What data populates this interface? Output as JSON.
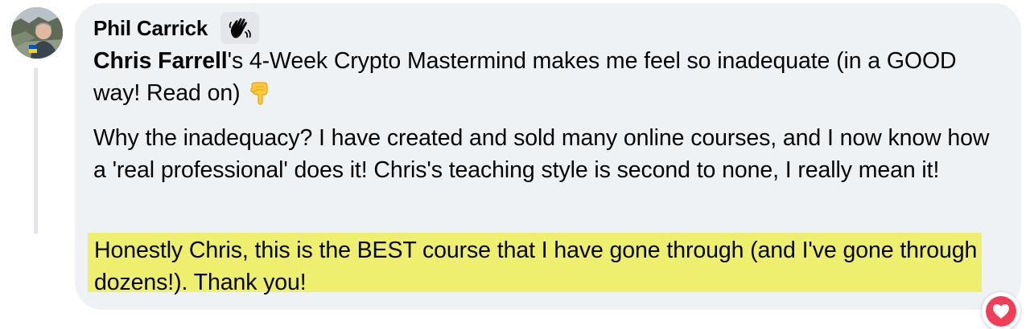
{
  "comment": {
    "author": "Phil Carrick",
    "badge_icon": "waving-hand-icon",
    "mention": "Chris Farrell",
    "paragraph1_text": "'s 4-Week Crypto Mastermind makes me feel so inadequate (in a GOOD way! Read on) ",
    "paragraph1_emoji": "pointing-down-hand-icon",
    "paragraph2": "Why the inadequacy? I have created and sold many online courses, and I now know how a 'real professional' does it! Chris's teaching style is second to none, I really mean it!",
    "paragraph3_highlighted": "Honestly Chris, this is the BEST course that I have gone through (and I've gone through dozens!). Thank you!",
    "highlight_color": "#eeef6e",
    "bubble_color": "#eff2f5"
  },
  "reaction": {
    "type": "love",
    "icon": "heart-icon",
    "color": "#f33e58"
  }
}
